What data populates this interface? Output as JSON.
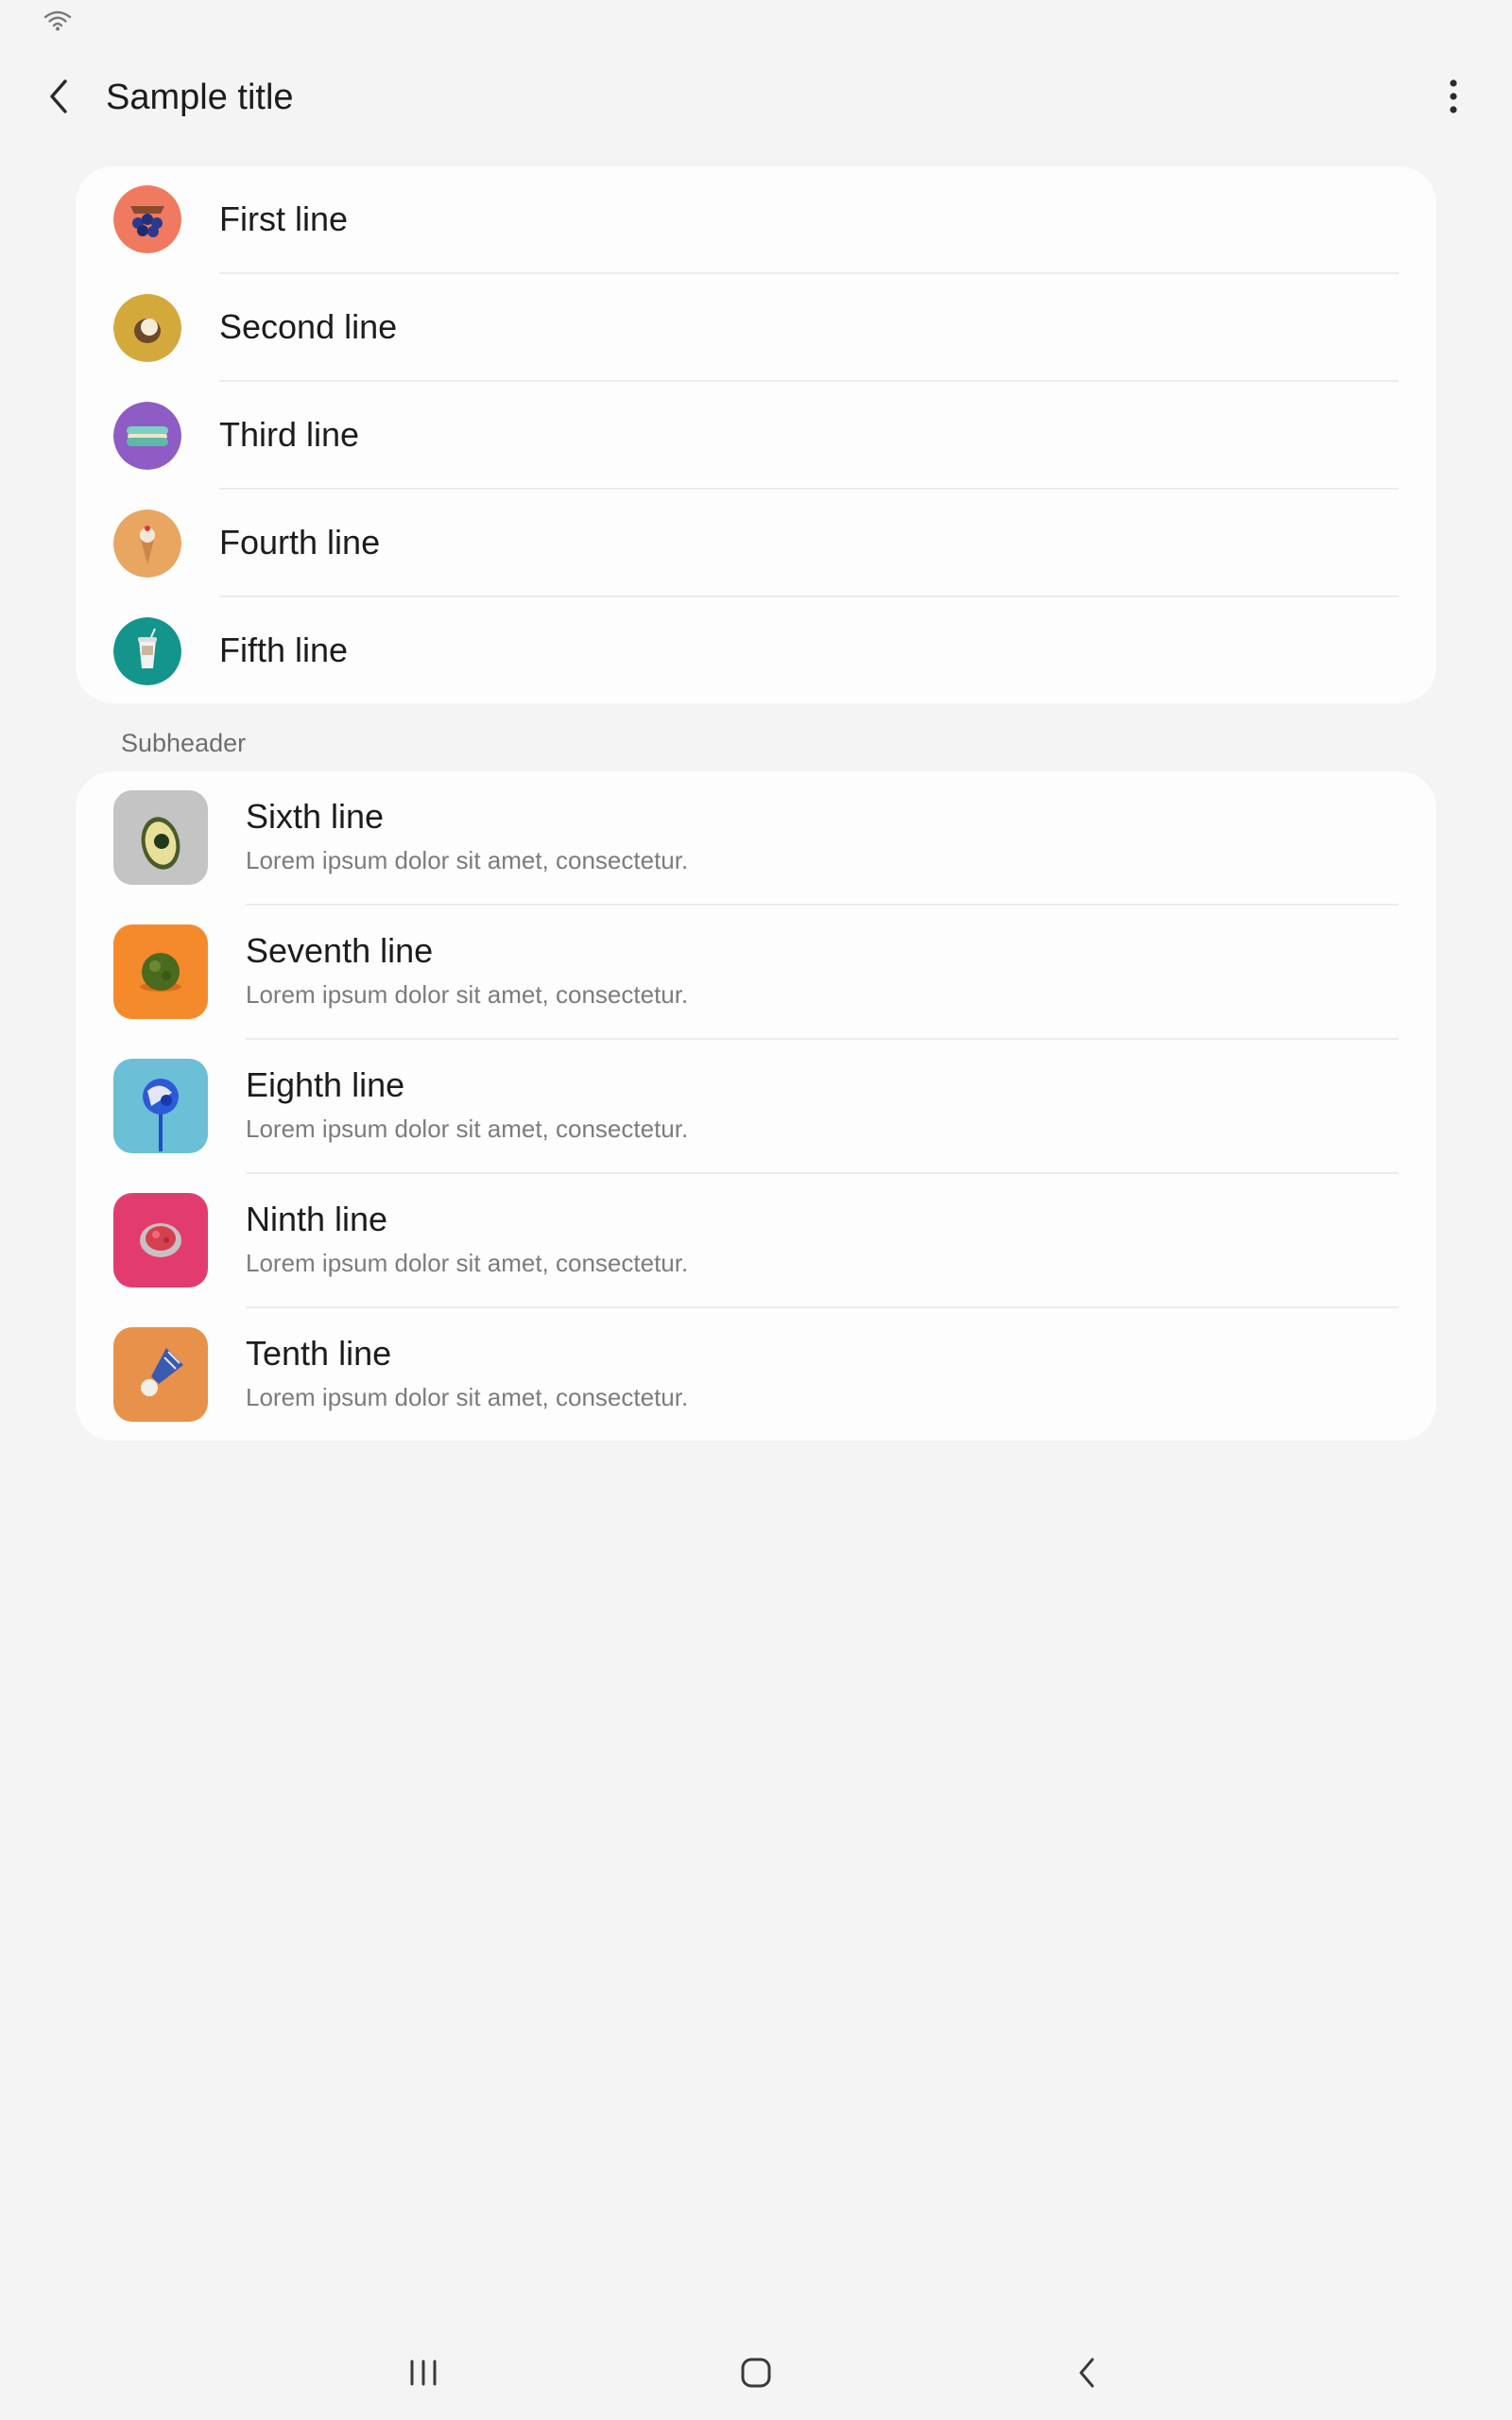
{
  "status_bar": {
    "wifi_icon": "wifi-icon"
  },
  "app_bar": {
    "back_icon": "chevron-left-icon",
    "title": "Sample title",
    "more_icon": "more-vertical-icon"
  },
  "list_one": {
    "items": [
      {
        "label": "First line",
        "icon": "blueberries-icon",
        "color": "#f07a5f"
      },
      {
        "label": "Second line",
        "icon": "coconut-icon",
        "color": "#d4a93c"
      },
      {
        "label": "Third line",
        "icon": "macaron-icon",
        "color": "#8e5cc4"
      },
      {
        "label": "Fourth line",
        "icon": "ice-cream-icon",
        "color": "#e8a660"
      },
      {
        "label": "Fifth line",
        "icon": "cup-icon",
        "color": "#14958c"
      }
    ]
  },
  "subheader": "Subheader",
  "list_two": {
    "items": [
      {
        "label": "Sixth line",
        "sub": "Lorem ipsum dolor sit amet, consectetur.",
        "icon": "avocado-icon",
        "color": "#c4c4c4"
      },
      {
        "label": "Seventh line",
        "sub": "Lorem ipsum dolor sit amet, consectetur.",
        "icon": "moss-ball-icon",
        "color": "#f58a2c"
      },
      {
        "label": "Eighth line",
        "sub": "Lorem ipsum dolor sit amet, consectetur.",
        "icon": "lollipop-icon",
        "color": "#6bbfd6"
      },
      {
        "label": "Ninth line",
        "sub": "Lorem ipsum dolor sit amet, consectetur.",
        "icon": "pom-pom-icon",
        "color": "#e23c6e"
      },
      {
        "label": "Tenth line",
        "sub": "Lorem ipsum dolor sit amet, consectetur.",
        "icon": "shuttlecock-icon",
        "color": "#e8914a"
      }
    ]
  },
  "nav_bar": {
    "recents_icon": "recents-icon",
    "home_icon": "home-icon",
    "back_icon": "back-icon"
  }
}
